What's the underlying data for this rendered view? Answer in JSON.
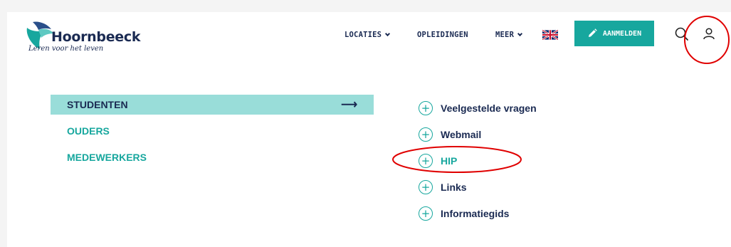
{
  "brand": {
    "name": "Hoornbeeck",
    "tagline": "Leren voor het leven",
    "accent": "#17a79e",
    "navy": "#1a2a52"
  },
  "nav": {
    "locaties": "LOCATIES",
    "opleidingen": "OPLEIDINGEN",
    "meer": "MEER",
    "language_icon": "uk-flag-icon",
    "aanmelden": "AANMELDEN",
    "search_icon": "search-icon",
    "user_icon": "user-icon"
  },
  "menu": {
    "groups": [
      {
        "label": "STUDENTEN",
        "active": true
      },
      {
        "label": "OUDERS",
        "active": false
      },
      {
        "label": "MEDEWERKERS",
        "active": false
      }
    ],
    "links": [
      {
        "label": "Veelgestelde vragen"
      },
      {
        "label": "Webmail"
      },
      {
        "label": "HIP",
        "highlighted": true
      },
      {
        "label": "Links"
      },
      {
        "label": "Informatiegids"
      }
    ]
  },
  "annotations": {
    "color": "#e00000"
  }
}
